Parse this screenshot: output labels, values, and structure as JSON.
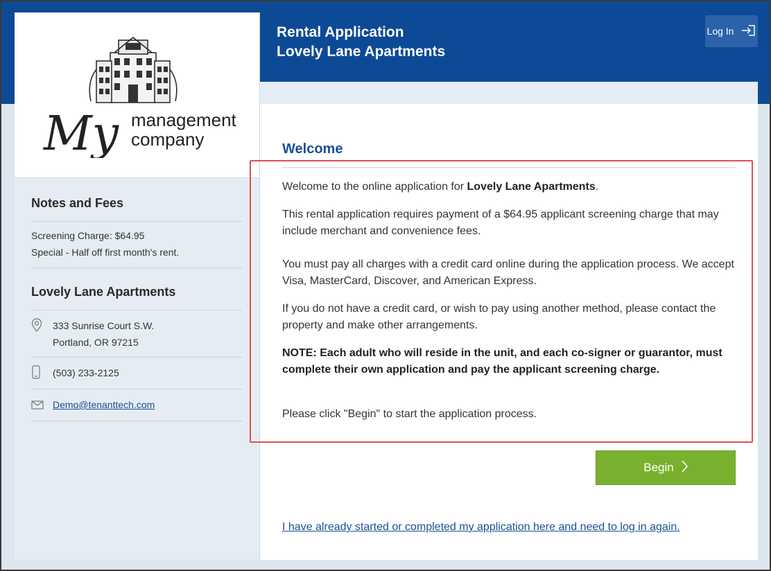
{
  "header": {
    "title_line1": "Rental Application",
    "title_line2": "Lovely Lane Apartments",
    "login_label": "Log In"
  },
  "logo": {
    "script_text": "My",
    "line1": "management",
    "line2": "company"
  },
  "sidebar": {
    "notes_heading": "Notes and Fees",
    "fees": [
      "Screening Charge: $64.95",
      "Special - Half off first month's rent."
    ],
    "property_heading": "Lovely Lane Apartments",
    "address_line1": "333 Sunrise Court S.W.",
    "address_line2": "Portland, OR 97215",
    "phone": "(503) 233-2125",
    "email": "Demo@tenanttech.com"
  },
  "main": {
    "welcome_title": "Welcome",
    "intro_prefix": "Welcome to the online application for ",
    "intro_property": "Lovely Lane Apartments",
    "intro_suffix": ".",
    "para_fee": "This rental application requires payment of a $64.95 applicant screening charge that may include merchant and convenience fees.",
    "para_payment": "You must pay all charges with a credit card online during the application process. We accept Visa, MasterCard, Discover, and American Express.",
    "para_no_card": "If you do not have a credit card, or wish to pay using another method, please contact the property and make other arrangements.",
    "para_note": "NOTE: Each adult who will reside in the unit, and each co-signer or guarantor, must complete their own application and pay the applicant screening charge.",
    "para_begin": "Please click \"Begin\" to start the application process.",
    "begin_label": "Begin",
    "relogin_link": "I have already started or completed my application here and need to log in again."
  },
  "colors": {
    "header_blue": "#0d4a96",
    "begin_green": "#79b12e",
    "highlight_red": "#e05050",
    "link_blue": "#1a4f95"
  },
  "icons": [
    "log-in-icon",
    "map-pin-icon",
    "phone-icon",
    "mail-icon",
    "chevron-right-icon",
    "building-logo"
  ]
}
